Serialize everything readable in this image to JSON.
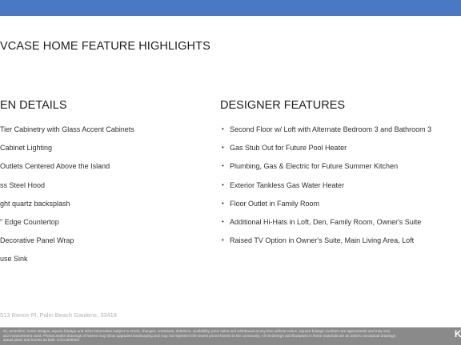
{
  "title": "VCASE HOME FEATURE HIGHLIGHTS",
  "kitchen": {
    "heading": "EN DETAILS",
    "items": [
      "Tier Cabinetry with Glass Accent Cabinets",
      "Cabinet Lighting",
      "Outlets Centered Above the Island",
      "ss Steel Hood",
      "ght quartz backsplash",
      "\" Edge Countertop",
      "Decorative Panel Wrap",
      "use Sink"
    ]
  },
  "designer": {
    "heading": "DESIGNER FEATURES",
    "bullet": "•",
    "items": [
      "Second Floor w/ Loft with Alternate Bedroom 3 and Bathroom 3",
      "Gas Stub Out for Future Pool Heater",
      "Plumbing, Gas & Electric for Future Summer Kitchen",
      "Exterior Tankless Gas Water Heater",
      "Floor Outlet in Family Room",
      "Additional Hi-Hats in Loft, Den, Family Room, Owner's Suite",
      "Raised TV Option in Owner's Suite, Main Living Area, Loft"
    ]
  },
  "address": "513 Renoir Pl, Palm Beach Gardens, 33418",
  "disclaimer": {
    "line1": "es, amenities, home designs, square footage and other information subject to errors, changes, omissions, deletions, availability, price sales and withdrawal at any time without notice. Square footage numbers are approximate and may vary",
    "line2": "ard measurement used. Photos and/or drawings of homes may show upgraded landscaping and may not represent the lowest priced homes in the community. All renderings and floorplans in these materials are an artist's conceptual drawings",
    "line3": "actual plans and homes as built. CGC1509406"
  },
  "brand": "K",
  "colors": {
    "top_bar": "#4a78c2",
    "footer_bar": "#8a8a8a"
  }
}
